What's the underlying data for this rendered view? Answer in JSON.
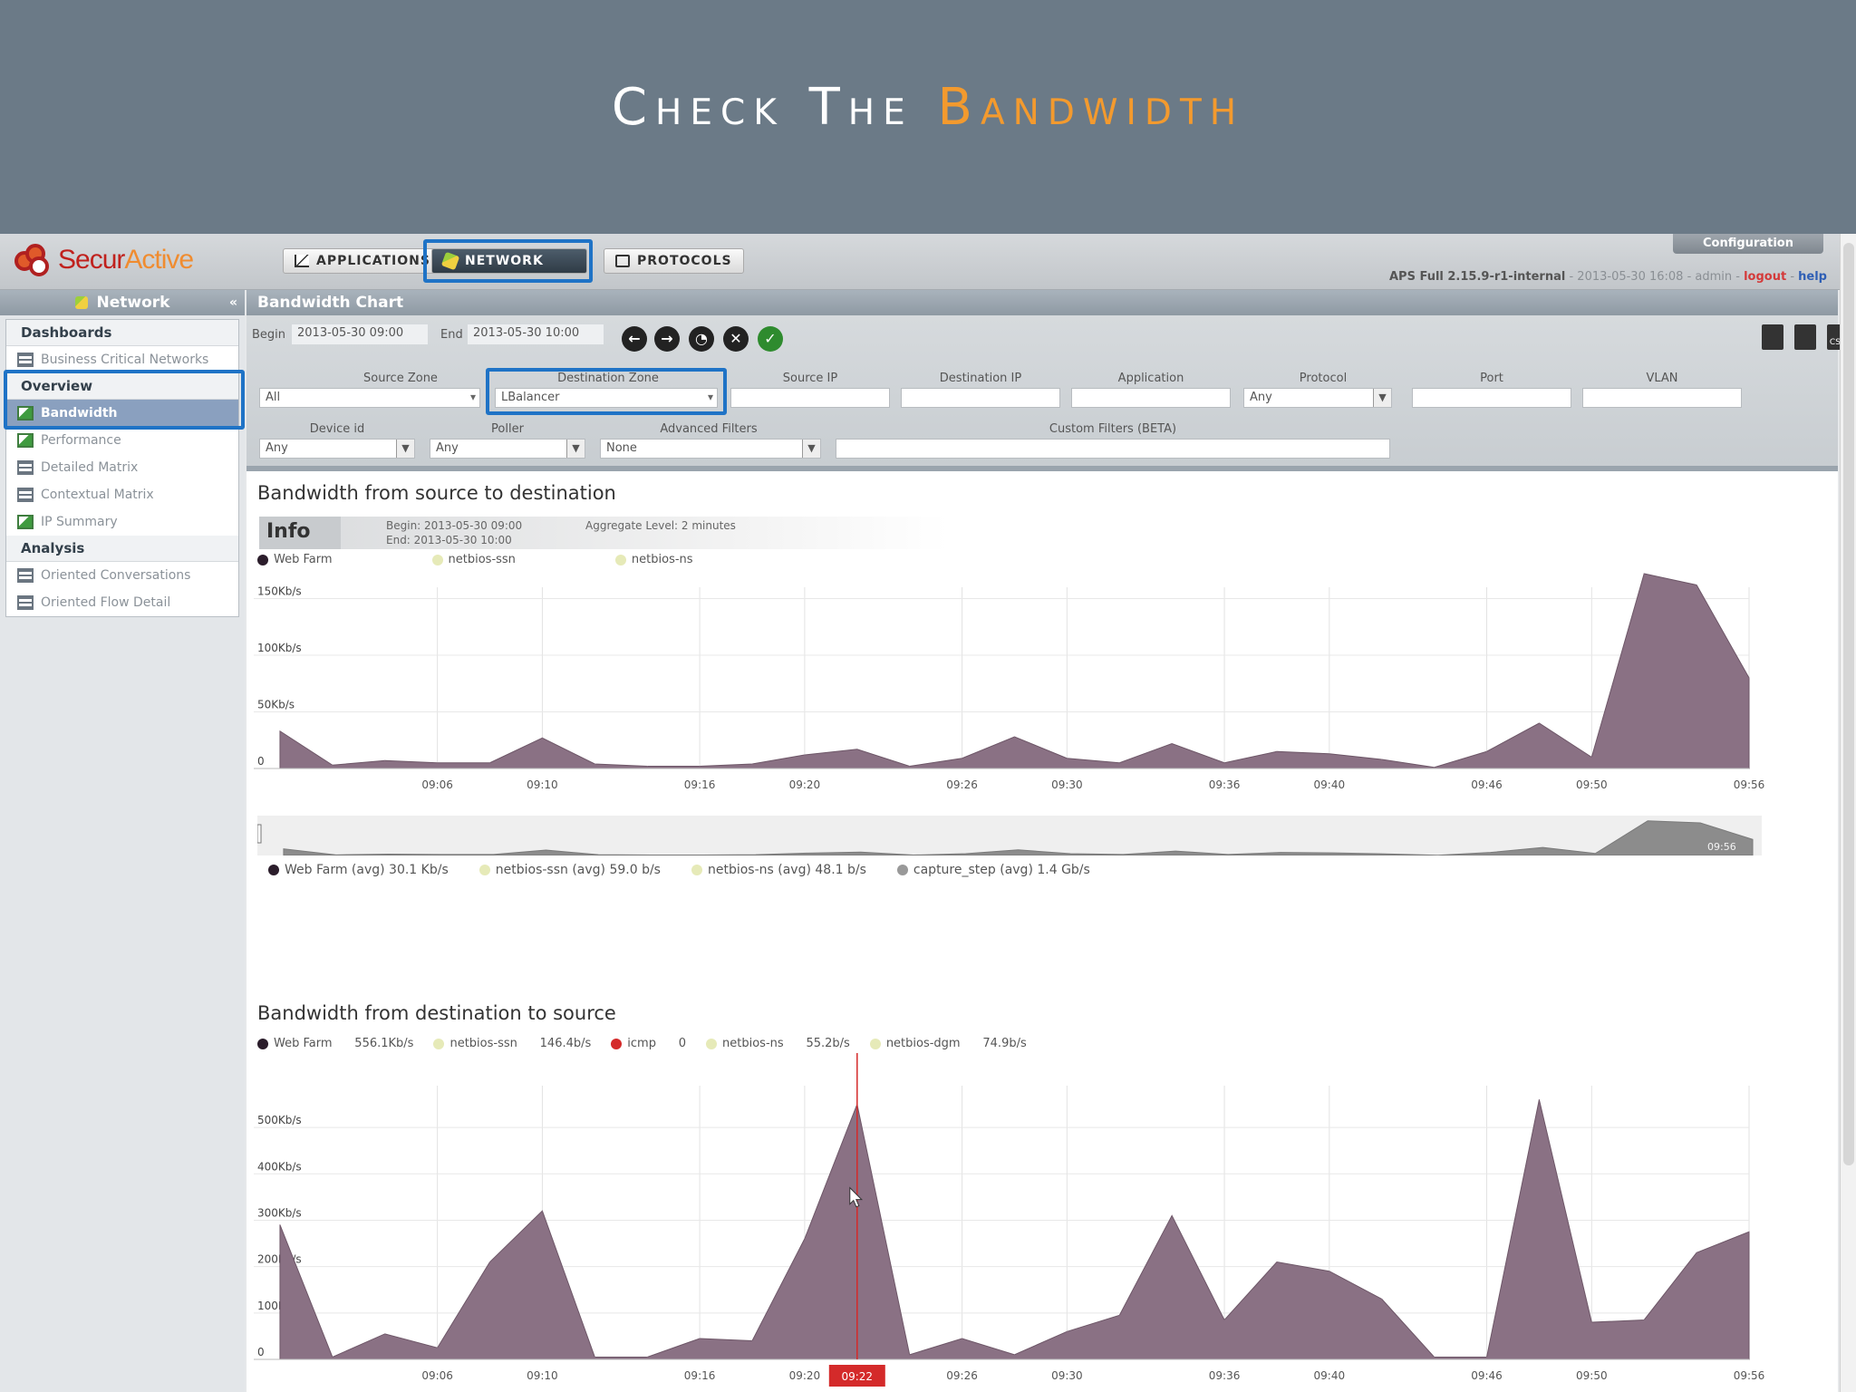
{
  "slide": {
    "title_part1": "Check The ",
    "title_part2": "Bandwidth"
  },
  "app": {
    "brand_part1": "Secur",
    "brand_part2": "Active",
    "tabs": [
      {
        "label": "APPLICATIONS",
        "icon": "chart-icon"
      },
      {
        "label": "NETWORK",
        "icon": "network-icon"
      },
      {
        "label": "PROTOCOLS",
        "icon": "protocols-icon"
      }
    ],
    "config_label": "Configuration",
    "version": "APS Full 2.15.9-r1-internal",
    "datetime": " - 2013-05-30 16:08 - admin - ",
    "logout": "logout",
    "sep": " - ",
    "help": "help"
  },
  "sidebar": {
    "title": "Network",
    "collapse": "«",
    "sections": [
      {
        "label": "Dashboards",
        "items": [
          {
            "label": "Business Critical Networks",
            "icon": "grid-icon",
            "active": false
          }
        ]
      },
      {
        "label": "Overview",
        "items": [
          {
            "label": "Bandwidth",
            "icon": "chart-icon",
            "active": true
          },
          {
            "label": "Performance",
            "icon": "chart-icon",
            "active": false
          },
          {
            "label": "Detailed Matrix",
            "icon": "grid-icon",
            "active": false
          },
          {
            "label": "Contextual Matrix",
            "icon": "grid-icon",
            "active": false
          },
          {
            "label": "IP Summary",
            "icon": "chart-icon",
            "active": false
          }
        ]
      },
      {
        "label": "Analysis",
        "items": [
          {
            "label": "Oriented Conversations",
            "icon": "grid-icon",
            "active": false
          },
          {
            "label": "Oriented Flow Detail",
            "icon": "grid-icon",
            "active": false
          }
        ]
      }
    ]
  },
  "main": {
    "title": "Bandwidth Chart",
    "begin_label": "Begin",
    "begin_value": "2013-05-30 09:00",
    "end_label": "End",
    "end_value": "2013-05-30 10:00",
    "filters": {
      "source_zone": {
        "label": "Source Zone",
        "value": "All"
      },
      "destination_zone": {
        "label": "Destination Zone",
        "value": "LBalancer"
      },
      "source_ip": {
        "label": "Source IP",
        "value": ""
      },
      "destination_ip": {
        "label": "Destination IP",
        "value": ""
      },
      "application": {
        "label": "Application",
        "value": ""
      },
      "protocol": {
        "label": "Protocol",
        "value": "Any"
      },
      "port": {
        "label": "Port",
        "value": ""
      },
      "vlan": {
        "label": "VLAN",
        "value": ""
      },
      "device_id": {
        "label": "Device id",
        "value": "Any"
      },
      "poller": {
        "label": "Poller",
        "value": "Any"
      },
      "advanced_filters": {
        "label": "Advanced Filters",
        "value": "None"
      },
      "custom_filters": {
        "label": "Custom Filters (BETA)",
        "value": ""
      }
    },
    "export_labels": [
      "",
      "",
      "CSV"
    ]
  },
  "info": {
    "tag": "Info",
    "begin": "Begin: 2013-05-30 09:00",
    "end": "End: 2013-05-30 10:00",
    "aggregate": "Aggregate Level: 2 minutes"
  },
  "chart_data": [
    {
      "type": "area",
      "title": "Bandwidth from source to destination",
      "legend": [
        {
          "name": "Web Farm",
          "color": "#2b1d2b"
        },
        {
          "name": "netbios-ssn",
          "color": "#e6eab8"
        },
        {
          "name": "netbios-ns",
          "color": "#e6eab8"
        }
      ],
      "y_ticks": [
        "0",
        "50Kb/s",
        "100Kb/s",
        "150Kb/s"
      ],
      "ylim": [
        0,
        160
      ],
      "x_ticks": [
        "09:06",
        "09:10",
        "09:16",
        "09:20",
        "09:26",
        "09:30",
        "09:36",
        "09:40",
        "09:46",
        "09:50",
        "09:56"
      ],
      "xlim_minutes": [
        59,
        116
      ],
      "series": [
        {
          "name": "Web Farm",
          "color": "#8a7184",
          "x_minutes": [
            60,
            62,
            64,
            66,
            68,
            70,
            72,
            74,
            76,
            78,
            80,
            82,
            84,
            86,
            88,
            90,
            92,
            94,
            96,
            98,
            100,
            102,
            104,
            106,
            108,
            110,
            112,
            114,
            116
          ],
          "values_kbps": [
            33,
            3,
            7,
            5,
            5,
            27,
            4,
            2,
            2,
            4,
            12,
            17,
            2,
            9,
            28,
            9,
            5,
            22,
            5,
            15,
            13,
            8,
            1,
            15,
            40,
            10,
            172,
            162,
            80
          ]
        }
      ],
      "summary": [
        {
          "label": "Web Farm (avg) 30.1 Kb/s",
          "color": "#2b1d2b"
        },
        {
          "label": "netbios-ssn (avg) 59.0 b/s",
          "color": "#e6eab8"
        },
        {
          "label": "netbios-ns (avg) 48.1 b/s",
          "color": "#e6eab8"
        },
        {
          "label": "capture_step (avg) 1.4 Gb/s",
          "color": "#999999"
        }
      ],
      "navigator_label": "09:56"
    },
    {
      "type": "area",
      "title": "Bandwidth from destination to source",
      "legend": [
        {
          "name": "Web Farm",
          "value": "556.1Kb/s",
          "color": "#2b1d2b"
        },
        {
          "name": "netbios-ssn",
          "value": "146.4b/s",
          "color": "#e6eab8"
        },
        {
          "name": "icmp",
          "value": "0",
          "color": "#d42a2a"
        },
        {
          "name": "netbios-ns",
          "value": "55.2b/s",
          "color": "#e6eab8"
        },
        {
          "name": "netbios-dgm",
          "value": "74.9b/s",
          "color": "#e6eab8"
        }
      ],
      "y_ticks": [
        "0",
        "100Kb/s",
        "200Kb/s",
        "300Kb/s",
        "400Kb/s",
        "500Kb/s"
      ],
      "ylim": [
        0,
        590
      ],
      "x_ticks": [
        "09:06",
        "09:10",
        "09:16",
        "09:20",
        "09:26",
        "09:30",
        "09:36",
        "09:40",
        "09:46",
        "09:50",
        "09:56"
      ],
      "xlim_minutes": [
        59,
        116
      ],
      "cursor": {
        "x_minute": 82,
        "label": "09:22"
      },
      "series": [
        {
          "name": "Web Farm",
          "color": "#8a7184",
          "x_minutes": [
            60,
            62,
            64,
            66,
            68,
            70,
            72,
            74,
            76,
            78,
            80,
            82,
            84,
            86,
            88,
            90,
            92,
            94,
            96,
            98,
            100,
            102,
            104,
            106,
            108,
            110,
            112,
            114,
            116
          ],
          "values_kbps": [
            290,
            5,
            55,
            25,
            210,
            320,
            5,
            5,
            45,
            40,
            260,
            550,
            10,
            45,
            10,
            60,
            95,
            310,
            85,
            210,
            190,
            130,
            5,
            5,
            560,
            80,
            85,
            230,
            275
          ]
        }
      ]
    }
  ]
}
